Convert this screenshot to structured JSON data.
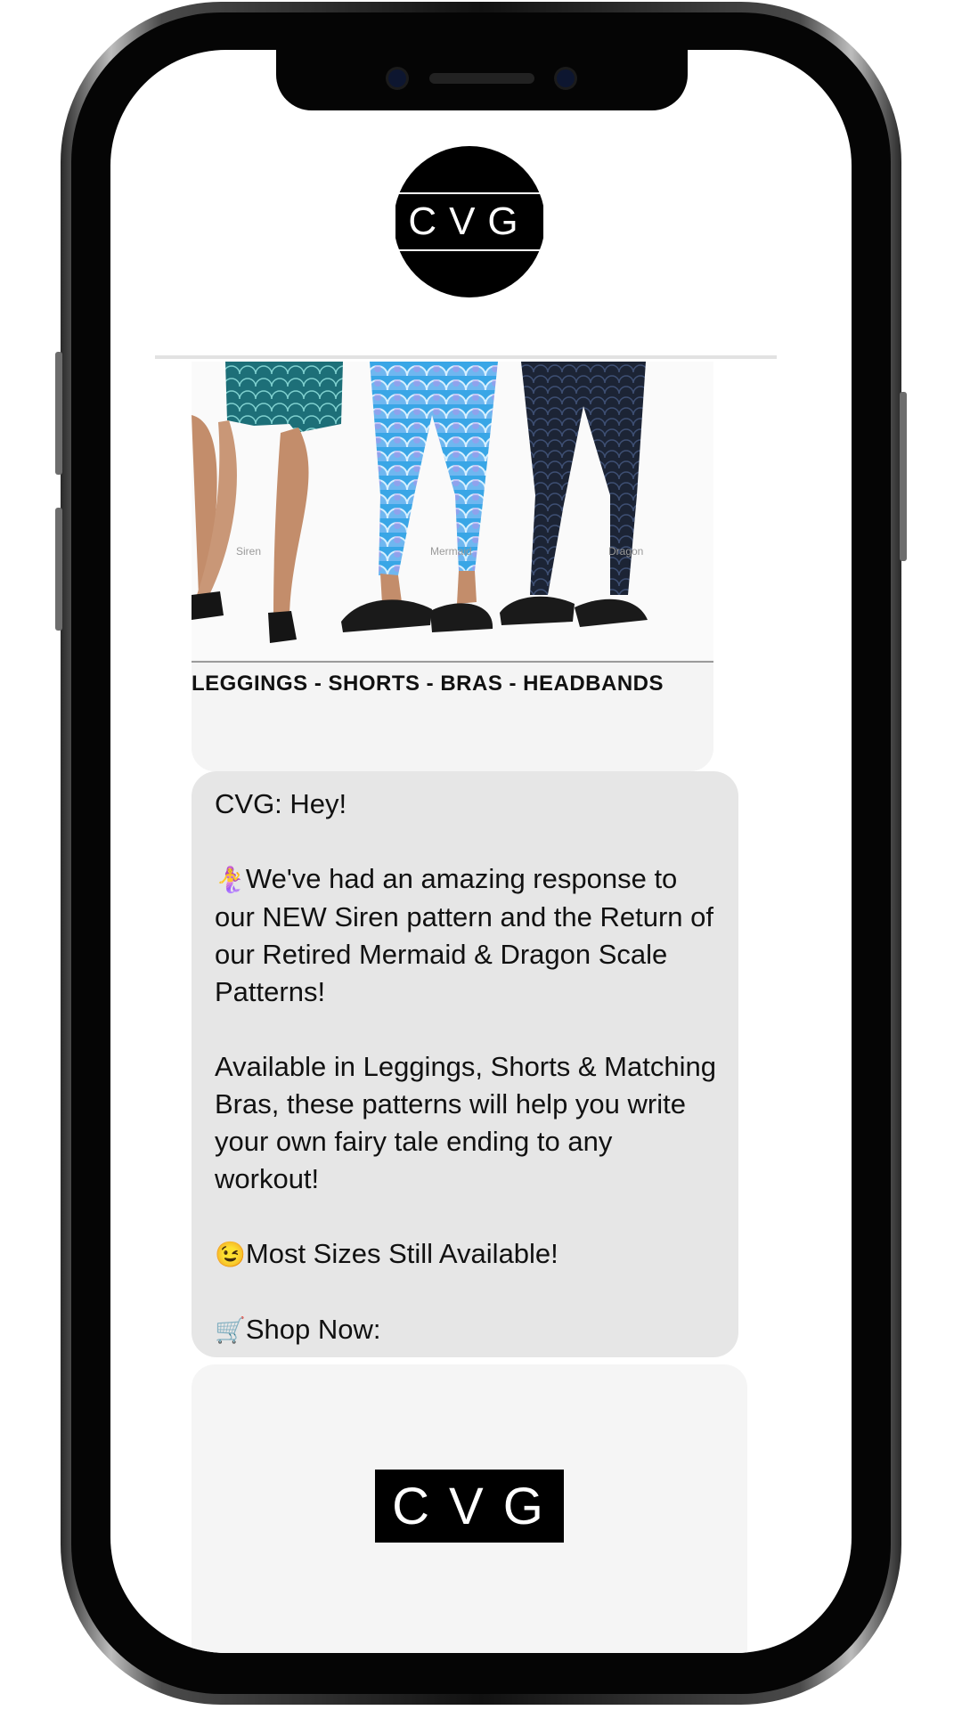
{
  "brand": {
    "logo_text": "CVG"
  },
  "mms": {
    "caption": "LEGGINGS - SHORTS - BRAS - HEADBANDS",
    "photo_labels": [
      "Siren",
      "Mermaid",
      "Dragon"
    ]
  },
  "message": {
    "line_greeting": "CVG: Hey!",
    "p1_emoji": "🧜‍♀️",
    "p1": "We've had an amazing response to our NEW Siren pattern and the Return of our Retired Mermaid & Dragon Scale Patterns!",
    "p2": "Available in Leggings, Shorts & Matching Bras, these patterns will help you write your own fairy tale ending to any workout!",
    "p3_emoji": "😉",
    "p3": "Most Sizes Still Available!",
    "p4_emoji": "🛒",
    "p4": "Shop Now:"
  },
  "link_preview": {
    "logo_text": "CVG"
  },
  "colors": {
    "bubble": "#e6e6e6",
    "frame": "#050505",
    "teal": "#1d6f78",
    "mermaid_blue": "#39a6e6",
    "dragon_navy": "#1c2435"
  }
}
